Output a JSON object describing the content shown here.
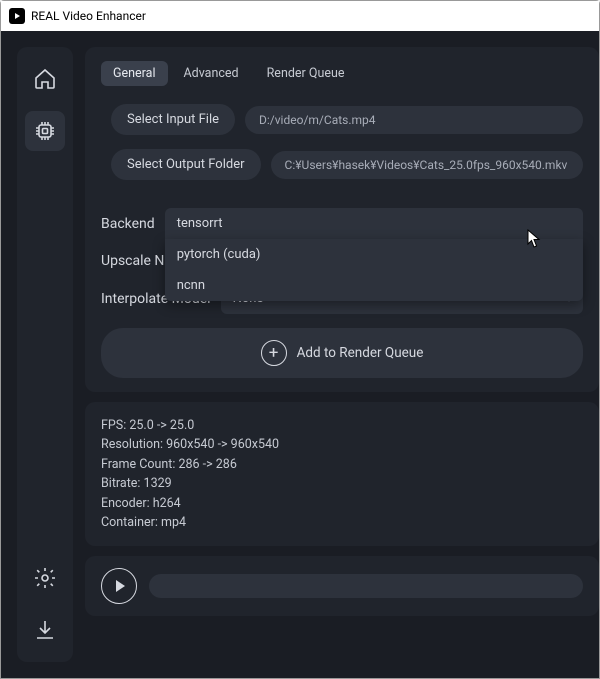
{
  "window": {
    "title": "REAL Video Enhancer"
  },
  "tabs": {
    "general": "General",
    "advanced": "Advanced",
    "queue": "Render Queue"
  },
  "io": {
    "input_btn": "Select Input File",
    "input_path": "D:/video/m/Cats.mp4",
    "output_btn": "Select Output Folder",
    "output_path": "C:¥Users¥hasek¥Videos¥Cats_25.0fps_960x540.mkv"
  },
  "backend": {
    "label": "Backend",
    "selected": "tensorrt",
    "options": [
      "tensorrt",
      "pytorch (cuda)",
      "ncnn"
    ]
  },
  "upscale": {
    "label": "Upscale N"
  },
  "interpolate": {
    "label": "Interpolate Model",
    "selected": "None"
  },
  "queue_btn": "Add to Render Queue",
  "info": {
    "fps": "FPS: 25.0 -> 25.0",
    "res": "Resolution: 960x540 -> 960x540",
    "frames": "Frame Count: 286 -> 286",
    "bitrate": "Bitrate: 1329",
    "encoder": "Encoder: h264",
    "container": "Container: mp4"
  }
}
